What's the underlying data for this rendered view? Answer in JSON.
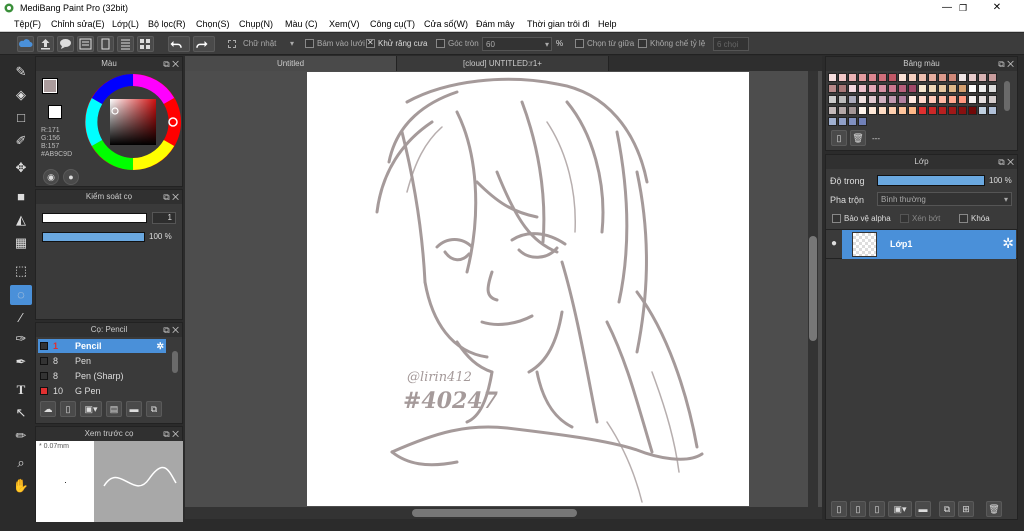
{
  "window": {
    "title": "MediBang Paint Pro (32bit)"
  },
  "menu": [
    "Tệp(F)",
    "Chỉnh sửa(E)",
    "Lớp(L)",
    "Bộ lọc(R)",
    "Chọn(S)",
    "Chụp(N)",
    "Màu (C)",
    "Xem(V)",
    "Công cụ(T)",
    "Cửa số(W)",
    "Đám mây",
    "Thời gian trôi đi",
    "Help"
  ],
  "toolbar": {
    "shape_select": "Chữ nhật",
    "snap_grid": "Bám vào lưới",
    "antialias": "Khử răng cưa",
    "round_corner": "Góc tròn",
    "round_value": "60",
    "percent": "%",
    "select_center": "Chọn từ giữa",
    "fixed_ratio": "Không chế tỷ lệ",
    "ratio_placeholder": "6 chọi"
  },
  "color_panel": {
    "title": "Màu",
    "r": "R:171",
    "g": "G:156",
    "b": "B:157",
    "hex": "#AB9C9D",
    "fg": "#AB9C9D"
  },
  "brush_control": {
    "title": "Kiểm soát cọ",
    "size": "1",
    "opacity": "100 %",
    "opacity_value": 1.0
  },
  "brush_panel": {
    "title": "Cọ: Pencil",
    "items": [
      {
        "size": "1",
        "name": "Pencil",
        "color": "#333333",
        "selected": true
      },
      {
        "size": "8",
        "name": "Pen",
        "color": "#333333",
        "selected": false
      },
      {
        "size": "8",
        "name": "Pen (Sharp)",
        "color": "#333333",
        "selected": false
      },
      {
        "size": "10",
        "name": "G Pen",
        "color": "#e03030",
        "selected": false
      }
    ]
  },
  "brush_preview": {
    "title": "Xem trước cọ",
    "size": "* 0.07mm"
  },
  "tabs": [
    {
      "label": "Untitled",
      "active": true
    },
    {
      "label": "[cloud] UNTITLED:r1+",
      "active": false
    }
  ],
  "palette": {
    "title": "Bảng màu",
    "label": "---"
  },
  "layer_panel": {
    "title": "Lớp",
    "opacity_label": "Độ trong",
    "opacity": "100 %",
    "opacity_value": 1.0,
    "blend_label": "Pha trộn",
    "blend_value": "Bình thường",
    "protect_alpha": "Bảo vệ alpha",
    "clipping": "Xén bớt",
    "lock": "Khóa",
    "layers": [
      {
        "name": "Lớp1"
      }
    ]
  },
  "watermark": {
    "line1": "@lirin412",
    "line2": "#40247"
  }
}
